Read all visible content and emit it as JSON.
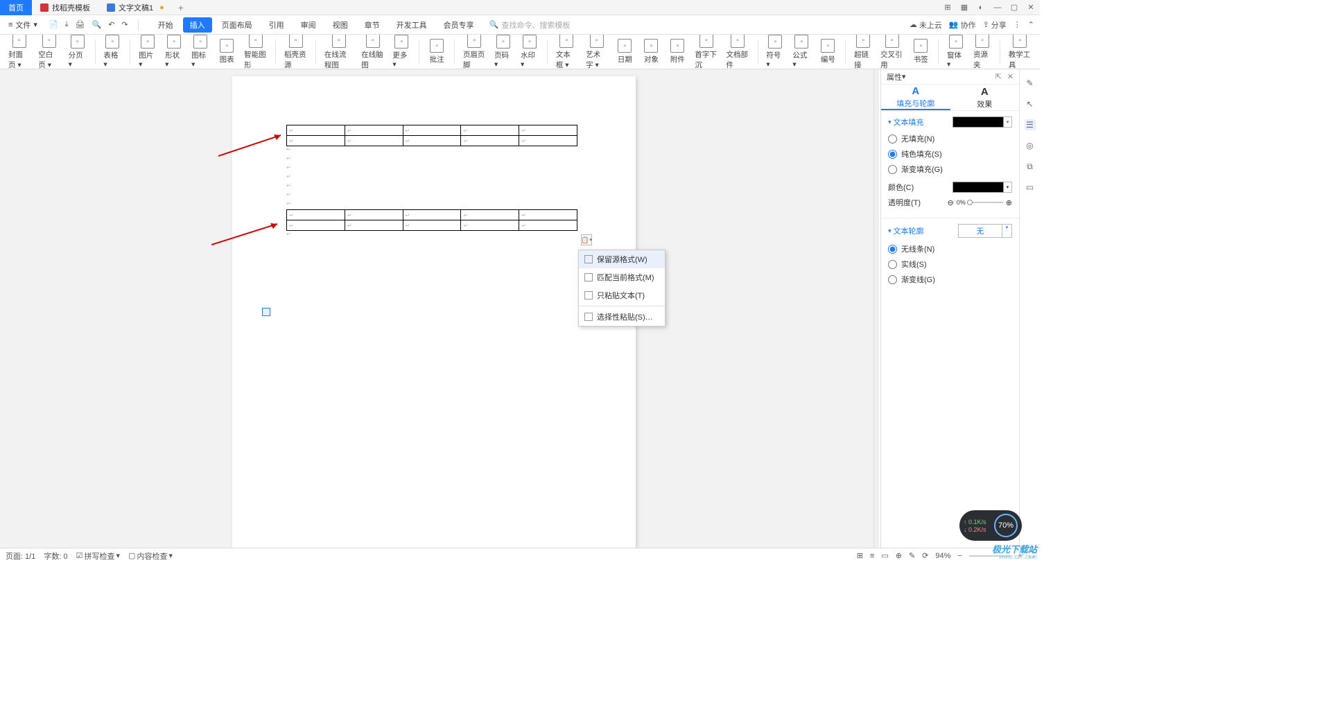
{
  "tabs": {
    "home": "首页",
    "template": "找稻壳模板",
    "doc": "文字文稿1",
    "dirty": "●",
    "add": "+"
  },
  "window_controls": {
    "tiles": "⊞",
    "grid": "▦",
    "user": "◐",
    "min": "—",
    "max": "▢",
    "close": "✕"
  },
  "file_btn": "文件",
  "qat_icons": [
    "📄",
    "⤓",
    "🖨",
    "🔍",
    "↶",
    "↷"
  ],
  "menus": [
    "开始",
    "插入",
    "页面布局",
    "引用",
    "审阅",
    "视图",
    "章节",
    "开发工具",
    "会员专享"
  ],
  "active_menu": 1,
  "search_placeholder": "查找命令、搜索模板",
  "menu_right": {
    "cloud": "未上云",
    "collab": "协作",
    "share": "分享"
  },
  "ribbon": [
    {
      "lbl": "封面页",
      "drop": true
    },
    {
      "lbl": "空白页",
      "drop": true
    },
    {
      "lbl": "分页",
      "drop": true
    },
    "sep",
    {
      "lbl": "表格",
      "drop": true
    },
    "sep",
    {
      "lbl": "图片",
      "drop": true
    },
    {
      "lbl": "形状",
      "drop": true
    },
    {
      "lbl": "图标",
      "drop": true
    },
    {
      "lbl": "图表",
      "inline": true
    },
    {
      "lbl": "智能图形",
      "inline": true
    },
    "sep",
    {
      "lbl": "稻壳资源"
    },
    "sep",
    {
      "lbl": "在线流程图"
    },
    {
      "lbl": "在线脑图"
    },
    {
      "lbl": "更多",
      "drop": true
    },
    "sep",
    {
      "lbl": "批注"
    },
    "sep",
    {
      "lbl": "页眉页脚"
    },
    {
      "lbl": "页码",
      "drop": true
    },
    {
      "lbl": "水印",
      "drop": true
    },
    "sep",
    {
      "lbl": "文本框",
      "drop": true
    },
    {
      "lbl": "艺术字",
      "drop": true
    },
    {
      "lbl": "日期"
    },
    {
      "lbl": "对象",
      "inline": true
    },
    {
      "lbl": "附件",
      "inline": true
    },
    {
      "lbl": "首字下沉",
      "inline": true
    },
    {
      "lbl": "文档部件",
      "inline": true
    },
    "sep",
    {
      "lbl": "符号",
      "drop": true
    },
    {
      "lbl": "公式",
      "drop": true
    },
    {
      "lbl": "编号"
    },
    "sep",
    {
      "lbl": "超链接"
    },
    {
      "lbl": "交叉引用",
      "inline": true
    },
    {
      "lbl": "书签",
      "inline": true
    },
    "sep",
    {
      "lbl": "窗体",
      "drop": true
    },
    {
      "lbl": "资源夹"
    },
    "sep",
    {
      "lbl": "教学工具"
    }
  ],
  "ctx": {
    "keep_source": "保留源格式(W)",
    "match_dest": "匹配当前格式(M)",
    "text_only": "只粘贴文本(T)",
    "paste_special": "选择性粘贴(S)…"
  },
  "panel": {
    "title": "属性",
    "tab_fill": "填充与轮廓",
    "tab_effect": "效果",
    "sec_fill": "文本填充",
    "opt_nofill": "无填充(N)",
    "opt_solid": "纯色填充(S)",
    "opt_grad": "渐变填充(G)",
    "color_label": "颜色(C)",
    "trans_label": "透明度(T)",
    "trans_val": "0%",
    "sec_outline": "文本轮廓",
    "outline_val": "无",
    "ol_none": "无线条(N)",
    "ol_solid": "实线(S)",
    "ol_grad": "渐变线(G)"
  },
  "status": {
    "page": "页面: 1/1",
    "words": "字数: 0",
    "spell": "拼写检查",
    "content": "内容检查",
    "zoom": "94%"
  },
  "net": {
    "up": "↑ 0.1K/s",
    "down": "↓ 0.2K/s",
    "pct": "70%"
  },
  "watermark": {
    "name": "极光下载站",
    "url": "www.xz7.com"
  }
}
